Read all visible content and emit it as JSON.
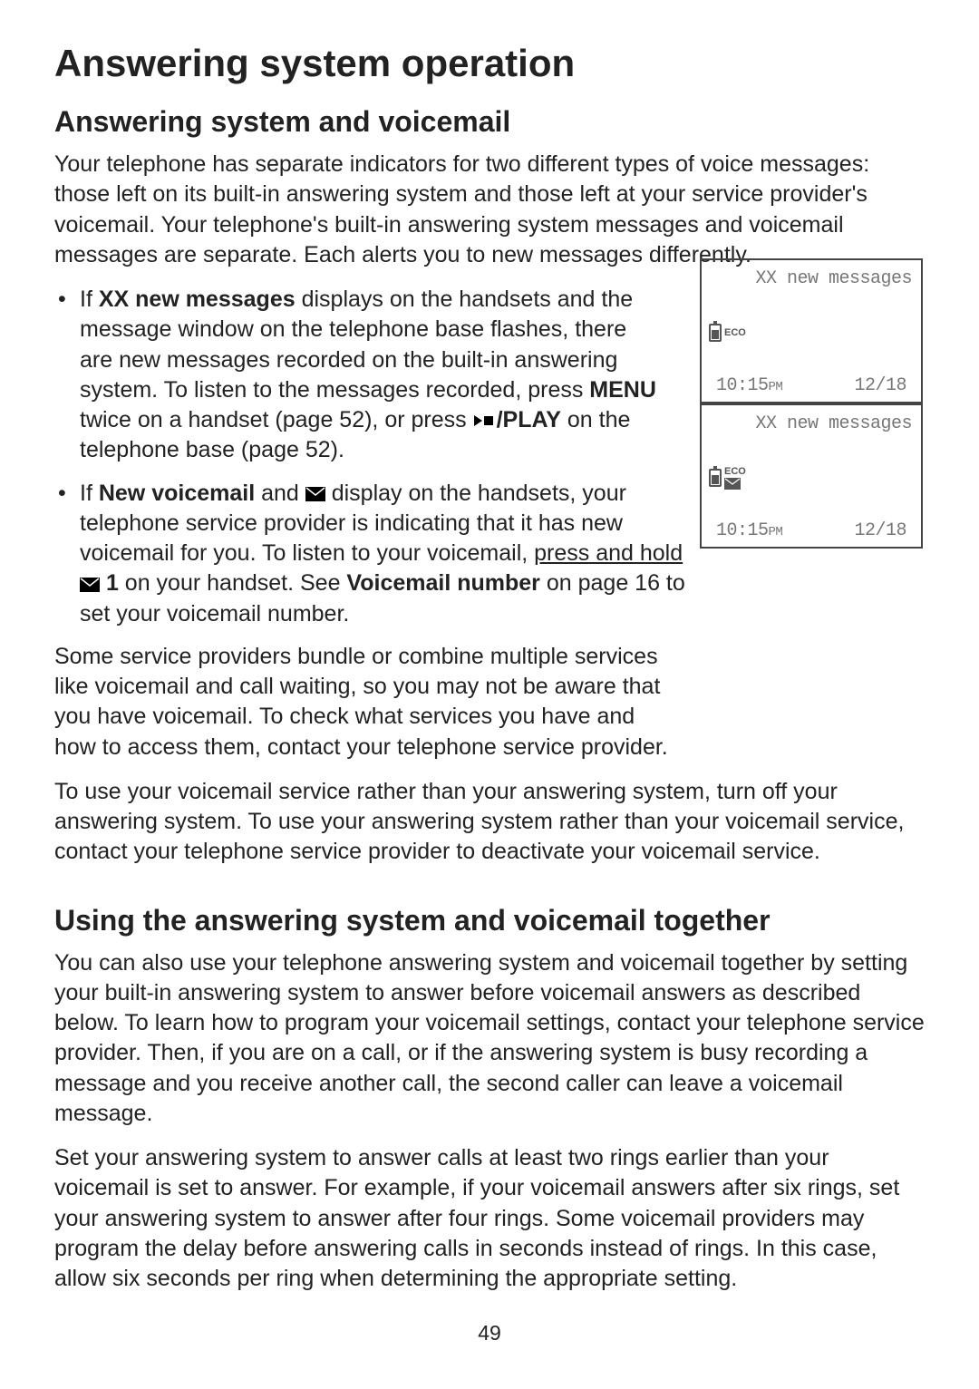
{
  "page": {
    "title": "Answering system operation",
    "section1": {
      "heading": "Answering system and voicemail",
      "intro": "Your telephone has separate indicators for two different types of voice messages: those left on its built-in answering system and those left at your service provider's voicemail. Your telephone's built-in answering system messages and voicemail messages are separate. Each alerts you to new messages differently.",
      "bullet1": {
        "pre": "If ",
        "b1": "XX new messages",
        "mid1": " displays on the handsets and the message window on the telephone base flashes, there are new messages recorded on the built-in answering system. To listen to the messages recorded, press ",
        "b2": "MENU",
        "mid2": " twice on a handset (page 52), or press ",
        "b3": "/PLAY",
        "end": " on the telephone base (page 52)."
      },
      "bullet2": {
        "pre": "If ",
        "b1": "New voicemail",
        "mid1": " and ",
        "mid2": " display on the handsets, your telephone service provider is indicating that it has new voicemail for you. To listen to your voicemail, ",
        "u1": "press and hold",
        "mid3": " ",
        "b2": "1",
        "mid4": " on your handset. See ",
        "b3": "Voicemail number",
        "end": " on page 16 to set your voicemail number."
      },
      "para2": "Some service providers bundle or combine multiple services like voicemail and call waiting, so you may not be aware that you have voicemail. To check what services you have and how to access them, contact your telephone service provider.",
      "para3": "To use your voicemail service rather than your answering system, turn off your answering system. To use your answering system rather than your voicemail service, contact your telephone service provider to deactivate your voicemail service."
    },
    "section2": {
      "heading": "Using the answering system and voicemail together",
      "para1": "You can also use your telephone answering system and voicemail together by setting your built-in answering system to answer before voicemail answers as described below. To learn how to program your voicemail settings, contact your telephone service provider. Then, if you are on a call, or if the answering system is busy recording a message and you receive another call, the second caller can leave a voicemail message.",
      "para2": "Set your answering system to answer calls at least two rings earlier than your voicemail is set to answer. For example, if your voicemail answers after six rings, set your answering system to answer after four rings. Some voicemail providers may program the delay before answering calls in seconds instead of rings. In this case, allow six seconds per ring when determining the appropriate setting."
    },
    "pagenum": "49"
  },
  "screens": {
    "s1": {
      "top": "XX new messages",
      "eco": "ECO",
      "time": "10:15",
      "ampm": "PM",
      "date": "12/18"
    },
    "s2": {
      "top": "XX new messages",
      "eco": "ECO",
      "time": "10:15",
      "ampm": "PM",
      "date": "12/18"
    }
  }
}
